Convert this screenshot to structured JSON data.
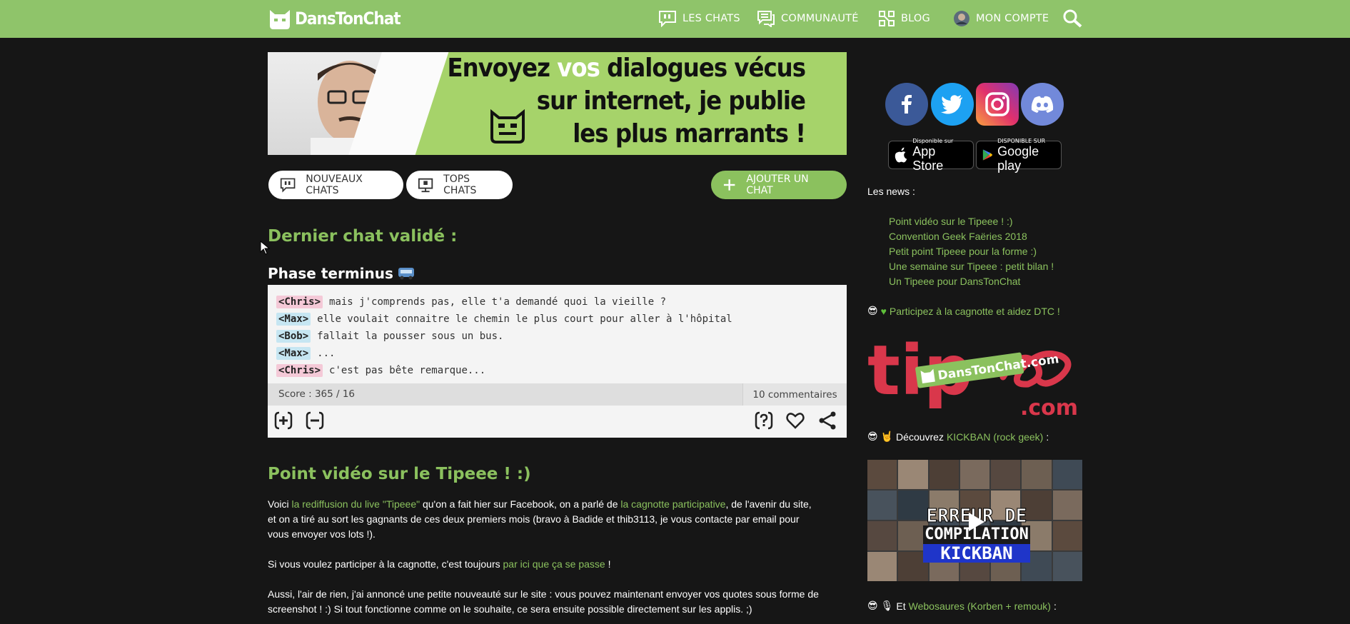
{
  "header": {
    "logo_text": "DansTonChat",
    "nav": {
      "chats": "LES CHATS",
      "communaute": "COMMUNAUTÉ",
      "blog": "BLOG",
      "account": "MON COMPTE"
    }
  },
  "banner": {
    "line1_a": "Envoyez ",
    "line1_hl": "vos",
    "line1_b": " dialogues vécus",
    "line2": "sur internet, je publie",
    "line3": "les plus marrants !"
  },
  "buttons": {
    "nouveaux": "NOUVEAUX CHATS",
    "tops": "TOPS CHATS",
    "ajouter": "AJOUTER UN CHAT"
  },
  "last_chat": {
    "section_title": "Dernier chat validé :",
    "title": "Phase terminus",
    "lines": [
      {
        "nick": "<Chris>",
        "text": "mais j'comprends pas, elle t'a demandé quoi la vieille ?",
        "color": "#f4c9d7"
      },
      {
        "nick": "<Max>",
        "text": "elle voulait connaitre le chemin le plus court pour aller à l'hôpital",
        "color": "#c6e6f2"
      },
      {
        "nick": "<Bob>",
        "text": "fallait la pousser sous un bus.",
        "color": "#c6e6f2"
      },
      {
        "nick": "<Max>",
        "text": "...",
        "color": "#c6e6f2"
      },
      {
        "nick": "<Chris>",
        "text": "c'est pas bête remarque...",
        "color": "#f4c9d7"
      }
    ],
    "score": "Score : 365 / 16",
    "comments": "10 commentaires"
  },
  "article": {
    "title": "Point vidéo sur le Tipeee ! :)",
    "p1": {
      "a": "Voici ",
      "link1": "la rediffusion du live \"Tipeee\"",
      "b": " qu'on a fait hier sur Facebook, on a parlé de ",
      "link2": "la cagnotte participative",
      "c": ", de l'avenir du site,",
      "line2": "et on a tiré au sort les gagnants de ces deux premiers mois (bravo à Badide et thib3113, je vous contacte par email pour",
      "line3": "vous envoyer vos lots !)."
    },
    "p2": {
      "a": "Si vous voulez participer à la cagnotte, c'est toujours ",
      "link": "par ici que ça se passe",
      "b": " !"
    },
    "p3": {
      "line1": "Aussi, l'air de rien, j'ai annoncé une petite nouveauté sur le site : vous pouvez maintenant envoyer vos quotes sous forme de",
      "line2": "screenshot ! :) Si tout fonctionne comme on le souhaite, ce sera ensuite possible directement sur les applis. ;)"
    }
  },
  "sidebar": {
    "appstore_small": "Disponible sur",
    "appstore_big": "App Store",
    "googleplay_small": "DISPONIBLE SUR",
    "googleplay_big": "Google play",
    "news_label": "Les news :",
    "news": [
      "Point vidéo sur le Tipeee ! :)",
      "Convention Geek Faëries 2018",
      "Petit point Tipeee pour la forme :)",
      "Une semaine sur Tipeee : petit bilan !",
      "Un Tipeee pour DansTonChat"
    ],
    "cagnotte": "Participez à la cagnotte et aidez DTC !",
    "tipee_badge": "DansTonChat.com",
    "tipee_word": "tip",
    "tipee_suffix": ".com",
    "kickban_a": "Découvrez ",
    "kickban_link": "KICKBAN (rock geek)",
    "kickban_b": " :",
    "video_line1": "ERREUR DE",
    "video_line2": "COMPILATION",
    "video_line3": "KICKBAN",
    "webo_a": "Et ",
    "webo_link": "Webosaures (Korben + remouk)",
    "webo_b": " :"
  },
  "colors": {
    "header_green": "#8fc46a",
    "accent_green": "#8bc15e",
    "background": "#161616",
    "facebook": "#3b5998",
    "twitter": "#1da1f2",
    "discord": "#7289da",
    "tipee_red": "#d9374b"
  }
}
